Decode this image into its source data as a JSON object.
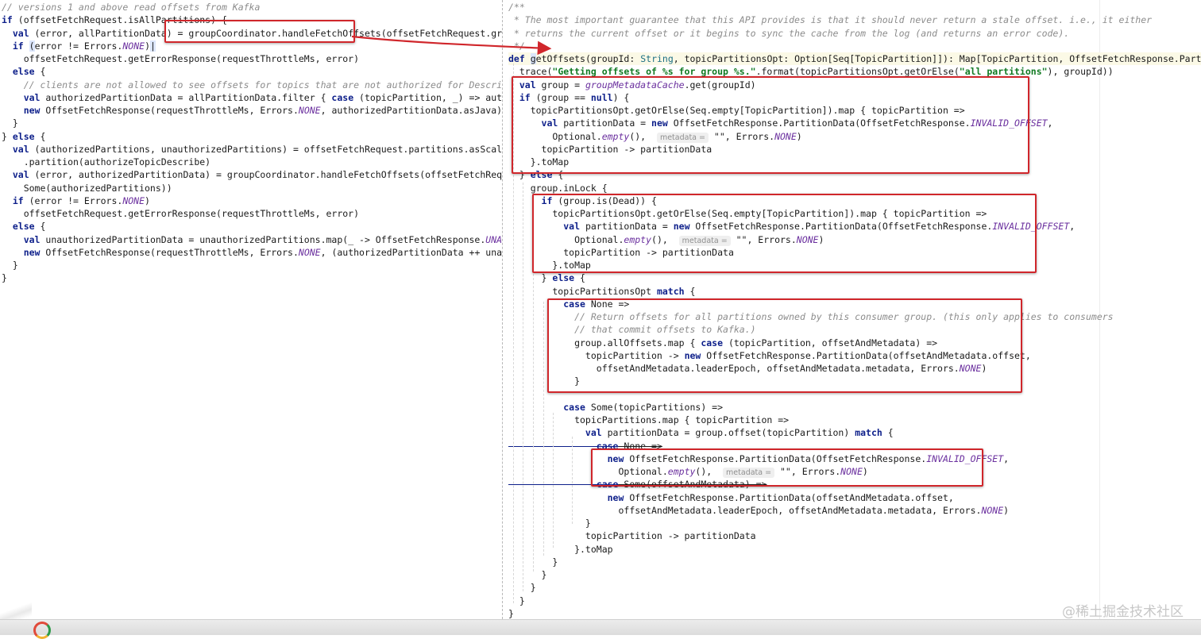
{
  "watermark": "@稀土掘金技术社区",
  "colors": {
    "annotation_box": "#d0262b",
    "keyword": "#0d1f8a",
    "string": "#117a22",
    "static_member": "#6a2f9e",
    "comment": "#8c8c8c"
  },
  "left_code": [
    [
      [
        "cm",
        "// versions 1 and above read offsets from Kafka"
      ]
    ],
    [
      [
        "kw",
        "if"
      ],
      [
        "id",
        " (offsetFetchRequest.isAllPartitions) {"
      ]
    ],
    [
      [
        "kw",
        "  val"
      ],
      [
        "id",
        " (error, allPartitionData) = groupCoordinator.handleFetchOffsets(offsetFetchRequest.groupId)"
      ]
    ],
    [
      [
        "kw",
        "  if"
      ],
      [
        "id",
        " "
      ],
      [
        "cur",
        "("
      ],
      [
        "id",
        "error != Errors."
      ],
      [
        "st",
        "NONE"
      ],
      [
        "id",
        ")"
      ],
      [
        "cur",
        "|"
      ]
    ],
    [
      [
        "id",
        "    offsetFetchRequest.getErrorResponse(requestThrottleMs, error)"
      ]
    ],
    [
      [
        "kw",
        "  else"
      ],
      [
        "id",
        " {"
      ]
    ],
    [
      [
        "cm",
        "    // clients are not allowed to see offsets for topics that are not authorized for Describe"
      ]
    ],
    [
      [
        "kw",
        "    val"
      ],
      [
        "id",
        " authorizedPartitionData = allPartitionData.filter { "
      ],
      [
        "kw",
        "case"
      ],
      [
        "id",
        " (topicPartition, _) => authorizeTopicDescribe(topicPartition) }"
      ]
    ],
    [
      [
        "kw",
        "    new"
      ],
      [
        "id",
        " OffsetFetchResponse(requestThrottleMs, Errors."
      ],
      [
        "st",
        "NONE"
      ],
      [
        "id",
        ", authorizedPartitionData.asJava)"
      ]
    ],
    [
      [
        "id",
        "  }"
      ]
    ],
    [
      [
        "id",
        "} "
      ],
      [
        "kw",
        "else"
      ],
      [
        "id",
        " {"
      ]
    ],
    [
      [
        "kw",
        "  val"
      ],
      [
        "id",
        " (authorizedPartitions, unauthorizedPartitions) = offsetFetchRequest.partitions.asScala"
      ]
    ],
    [
      [
        "id",
        "    .partition(authorizeTopicDescribe)"
      ]
    ],
    [
      [
        "kw",
        "  val"
      ],
      [
        "id",
        " (error, authorizedPartitionData) = groupCoordinator.handleFetchOffsets(offsetFetchRequest.groupId,"
      ]
    ],
    [
      [
        "id",
        "    Some(authorizedPartitions))"
      ]
    ],
    [
      [
        "kw",
        "  if"
      ],
      [
        "id",
        " (error != Errors."
      ],
      [
        "st",
        "NONE"
      ],
      [
        "id",
        ")"
      ]
    ],
    [
      [
        "id",
        "    offsetFetchRequest.getErrorResponse(requestThrottleMs, error)"
      ]
    ],
    [
      [
        "kw",
        "  else"
      ],
      [
        "id",
        " {"
      ]
    ],
    [
      [
        "kw",
        "    val"
      ],
      [
        "id",
        " unauthorizedPartitionData = unauthorizedPartitions.map(_ -> OffsetFetchResponse."
      ],
      [
        "st",
        "UNAUTHORIZED_PARTITION"
      ],
      [
        "id",
        ")"
      ]
    ],
    [
      [
        "kw",
        "    new"
      ],
      [
        "id",
        " OffsetFetchResponse(requestThrottleMs, Errors."
      ],
      [
        "st",
        "NONE"
      ],
      [
        "id",
        ", (authorizedPartitionData ++ unauthorizedPartitionData).asJava)"
      ]
    ],
    [
      [
        "id",
        "  }"
      ]
    ],
    [
      [
        "id",
        "}"
      ]
    ]
  ],
  "right_code": [
    [
      [
        "cm",
        "/**"
      ]
    ],
    [
      [
        "cm",
        " * The most important guarantee that this API provides is that it should never return a stale offset. i.e., it either"
      ]
    ],
    [
      [
        "cm",
        " * returns the current offset or it begins to sync the cache from the log (and returns an error code)."
      ]
    ],
    [
      [
        "cm",
        " */"
      ]
    ],
    [
      [
        "kw",
        "def"
      ],
      [
        "id",
        " "
      ],
      [
        "cur",
        "g"
      ],
      [
        "id",
        "etOffsets(groupId: "
      ],
      [
        "ty",
        "String"
      ],
      [
        "id",
        ", topicPartitionsOpt: Option[Seq[TopicPartition]]): Map[TopicPartition, OffsetFetchResponse.PartitionData] = {"
      ]
    ],
    [
      [
        "id",
        "  trace("
      ],
      [
        "str",
        "\"Getting offsets of %s for group %s.\""
      ],
      [
        "id",
        ".format(topicPartitionsOpt.getOrElse("
      ],
      [
        "str",
        "\"all partitions\""
      ],
      [
        "id",
        "), groupId))"
      ]
    ],
    [
      [
        "kw",
        "  val"
      ],
      [
        "id",
        " group = "
      ],
      [
        "fi",
        "groupMetadataCache"
      ],
      [
        "id",
        ".get(groupId)"
      ]
    ],
    [
      [
        "kw",
        "  if"
      ],
      [
        "id",
        " (group == "
      ],
      [
        "kw",
        "null"
      ],
      [
        "id",
        ") {"
      ]
    ],
    [
      [
        "id",
        "    topicPartitionsOpt.getOrElse(Seq.empty[TopicPartition]).map { topicPartition =>"
      ]
    ],
    [
      [
        "kw",
        "      val"
      ],
      [
        "id",
        " partitionData = "
      ],
      [
        "kw",
        "new"
      ],
      [
        "id",
        " OffsetFetchResponse.PartitionData(OffsetFetchResponse."
      ],
      [
        "st",
        "INVALID_OFFSET"
      ],
      [
        "id",
        ","
      ]
    ],
    [
      [
        "id",
        "        Optional."
      ],
      [
        "fi",
        "empty"
      ],
      [
        "id",
        "(),  "
      ],
      [
        "hint",
        "metadata ="
      ],
      [
        "id",
        " \"\", Errors."
      ],
      [
        "st",
        "NONE"
      ],
      [
        "id",
        ")"
      ]
    ],
    [
      [
        "id",
        "      topicPartition -> partitionData"
      ]
    ],
    [
      [
        "id",
        "    }.toMap"
      ]
    ],
    [
      [
        "id",
        "  } "
      ],
      [
        "kw",
        "else"
      ],
      [
        "id",
        " {"
      ]
    ],
    [
      [
        "id",
        "    group.inLock {"
      ]
    ],
    [
      [
        "kw",
        "      if"
      ],
      [
        "id",
        " (group.is(Dead)) {"
      ]
    ],
    [
      [
        "id",
        "        topicPartitionsOpt.getOrElse(Seq.empty[TopicPartition]).map { topicPartition =>"
      ]
    ],
    [
      [
        "kw",
        "          val"
      ],
      [
        "id",
        " partitionData = "
      ],
      [
        "kw",
        "new"
      ],
      [
        "id",
        " OffsetFetchResponse.PartitionData(OffsetFetchResponse."
      ],
      [
        "st",
        "INVALID_OFFSET"
      ],
      [
        "id",
        ","
      ]
    ],
    [
      [
        "id",
        "            Optional."
      ],
      [
        "fi",
        "empty"
      ],
      [
        "id",
        "(),  "
      ],
      [
        "hint",
        "metadata ="
      ],
      [
        "id",
        " \"\", Errors."
      ],
      [
        "st",
        "NONE"
      ],
      [
        "id",
        ")"
      ]
    ],
    [
      [
        "id",
        "          topicPartition -> partitionData"
      ]
    ],
    [
      [
        "id",
        "        }.toMap"
      ]
    ],
    [
      [
        "id",
        "      } "
      ],
      [
        "kw",
        "else"
      ],
      [
        "id",
        " {"
      ]
    ],
    [
      [
        "id",
        "        topicPartitionsOpt "
      ],
      [
        "kw",
        "match"
      ],
      [
        "id",
        " {"
      ]
    ],
    [
      [
        "kw",
        "          case"
      ],
      [
        "id",
        " None =>"
      ]
    ],
    [
      [
        "cm",
        "            // Return offsets for all partitions owned by this consumer group. (this only applies to consumers"
      ]
    ],
    [
      [
        "cm",
        "            // that commit offsets to Kafka.)"
      ]
    ],
    [
      [
        "id",
        "            group.allOffsets.map { "
      ],
      [
        "kw",
        "case"
      ],
      [
        "id",
        " (topicPartition, offsetAndMetadata) =>"
      ]
    ],
    [
      [
        "id",
        "              topicPartition -> "
      ],
      [
        "kw",
        "new"
      ],
      [
        "id",
        " OffsetFetchResponse.PartitionData(offsetAndMetadata.offset,"
      ]
    ],
    [
      [
        "id",
        "                offsetAndMetadata.leaderEpoch, offsetAndMetadata.metadata, Errors."
      ],
      [
        "st",
        "NONE"
      ],
      [
        "id",
        ")"
      ]
    ],
    [
      [
        "id",
        "            }"
      ]
    ],
    [
      [
        "id",
        ""
      ]
    ],
    [
      [
        "kw",
        "          case"
      ],
      [
        "id",
        " Some(topicPartitions) =>"
      ]
    ],
    [
      [
        "id",
        "            topicPartitions.map { topicPartition =>"
      ]
    ],
    [
      [
        "kw",
        "              val"
      ],
      [
        "id",
        " partitionData = group.offset(topicPartition) "
      ],
      [
        "kw",
        "match"
      ],
      [
        "id",
        " {"
      ]
    ],
    [
      [
        "kw",
        "                case"
      ],
      [
        "id",
        " None =>"
      ]
    ],
    [
      [
        "kw",
        "                  new"
      ],
      [
        "id",
        " OffsetFetchResponse.PartitionData(OffsetFetchResponse."
      ],
      [
        "st",
        "INVALID_OFFSET"
      ],
      [
        "id",
        ","
      ]
    ],
    [
      [
        "id",
        "                    Optional."
      ],
      [
        "fi",
        "empty"
      ],
      [
        "id",
        "(),  "
      ],
      [
        "hint",
        "metadata ="
      ],
      [
        "id",
        " \"\", Errors."
      ],
      [
        "st",
        "NONE"
      ],
      [
        "id",
        ")"
      ]
    ],
    [
      [
        "kw",
        "                case"
      ],
      [
        "id",
        " Some(offsetAndMetadata) =>"
      ]
    ],
    [
      [
        "kw",
        "                  new"
      ],
      [
        "id",
        " OffsetFetchResponse.PartitionData(offsetAndMetadata.offset,"
      ]
    ],
    [
      [
        "id",
        "                    offsetAndMetadata.leaderEpoch, offsetAndMetadata.metadata, Errors."
      ],
      [
        "st",
        "NONE"
      ],
      [
        "id",
        ")"
      ]
    ],
    [
      [
        "id",
        "              }"
      ]
    ],
    [
      [
        "id",
        "              topicPartition -> partitionData"
      ]
    ],
    [
      [
        "id",
        "            }.toMap"
      ]
    ],
    [
      [
        "id",
        "        }"
      ]
    ],
    [
      [
        "id",
        "      }"
      ]
    ],
    [
      [
        "id",
        "    }"
      ]
    ],
    [
      [
        "id",
        "  }"
      ]
    ],
    [
      [
        "id",
        "}"
      ]
    ]
  ]
}
